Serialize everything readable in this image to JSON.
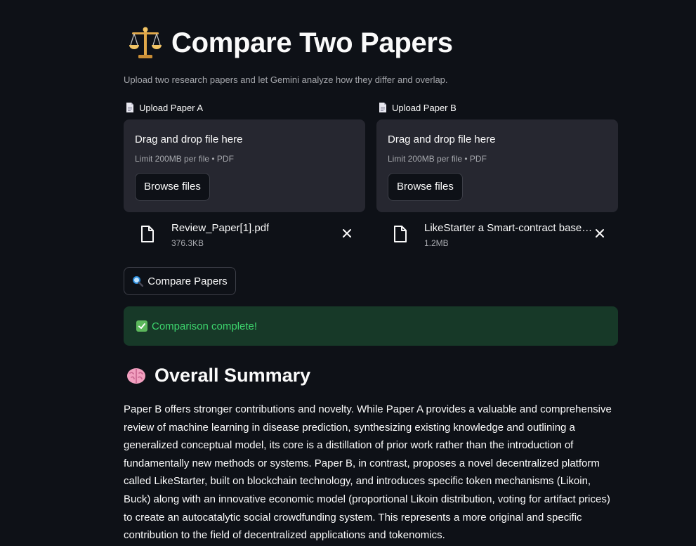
{
  "header": {
    "title": "Compare Two Papers",
    "subtitle": "Upload two research papers and let Gemini analyze how they differ and overlap."
  },
  "uploaders": [
    {
      "label": "Upload Paper A",
      "drop_text": "Drag and drop file here",
      "limit_text": "Limit 200MB per file • PDF",
      "browse_label": "Browse files",
      "file": {
        "name": "Review_Paper[1].pdf",
        "size": "376.3KB"
      }
    },
    {
      "label": "Upload Paper B",
      "drop_text": "Drag and drop file here",
      "limit_text": "Limit 200MB per file • PDF",
      "browse_label": "Browse files",
      "file": {
        "name": "LikeStarter a Smart-contract based Social DAO for Crowdfunding.pdf",
        "size": "1.2MB"
      }
    }
  ],
  "compare_button": {
    "label": "Compare Papers"
  },
  "status": {
    "message": "Comparison complete!"
  },
  "summary": {
    "heading": "Overall Summary",
    "text": "Paper B offers stronger contributions and novelty. While Paper A provides a valuable and comprehensive review of machine learning in disease prediction, synthesizing existing knowledge and outlining a generalized conceptual model, its core is a distillation of prior work rather than the introduction of fundamentally new methods or systems. Paper B, in contrast, proposes a novel decentralized platform called LikeStarter, built on blockchain technology, and introduces specific token mechanisms (Likoin, Buck) along with an innovative economic model (proportional Likoin distribution, voting for artifact prices) to create an autocatalytic social crowdfunding system. This represents a more original and specific contribution to the field of decentralized applications and tokenomics."
  },
  "icons": {
    "title": "balance-scale-icon",
    "upload_label": "document-icon",
    "file": "file-icon",
    "remove": "close-icon",
    "compare": "magnifier-icon",
    "status": "check-icon",
    "summary": "brain-icon"
  },
  "colors": {
    "background": "#0e1117",
    "panel": "#262730",
    "success_bg": "#173928",
    "success_text": "#3dd56d"
  }
}
